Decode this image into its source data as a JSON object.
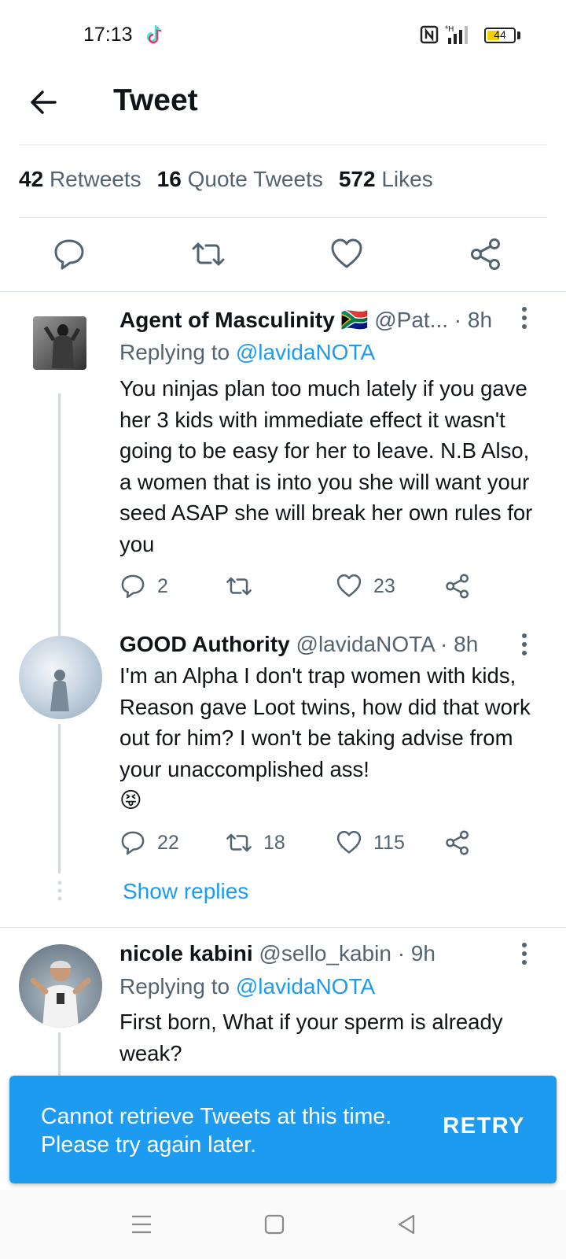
{
  "status_bar": {
    "time": "17:13",
    "battery": "44",
    "icons": [
      "tiktok-icon",
      "nfc-icon",
      "signal-icon",
      "battery-icon"
    ]
  },
  "header": {
    "title": "Tweet"
  },
  "stats": {
    "retweets_count": "42",
    "retweets_label": "Retweets",
    "quotes_count": "16",
    "quotes_label": "Quote Tweets",
    "likes_count": "572",
    "likes_label": "Likes"
  },
  "replies": [
    {
      "name": "Agent of Masculinity",
      "flag": "🇿🇦",
      "meta": "@Pat... · 8h",
      "replying_prefix": "Replying to ",
      "replying_handle": "@lavidaNOTA",
      "text": "You ninjas plan too much lately if you gave her 3 kids with immediate effect it wasn't going to be easy for her to leave. N.B Also, a women that is into you she will want your seed ASAP she will break her own rules for you",
      "reply_count": "2",
      "retweet_count": "",
      "like_count": "23"
    },
    {
      "name": "GOOD Authority",
      "meta": "@lavidaNOTA · 8h",
      "text": "I'm an Alpha I don't trap women with kids, Reason gave Loot twins, how did that work out for him? I won't be taking advise from your unaccomplished ass!",
      "emoji": "😝",
      "reply_count": "22",
      "retweet_count": "18",
      "like_count": "115"
    },
    {
      "name": "nicole kabini",
      "meta": "@sello_kabin · 9h",
      "replying_prefix": "Replying to ",
      "replying_handle": "@lavidaNOTA",
      "text": "First born, What if your sperm is already weak?"
    }
  ],
  "show_replies": "Show replies",
  "snackbar": {
    "message": "Cannot retrieve Tweets at this time. Please try again later.",
    "action": "RETRY"
  },
  "colors": {
    "accent": "#1d9bf0",
    "text": "#0f1419",
    "muted": "#536471"
  }
}
